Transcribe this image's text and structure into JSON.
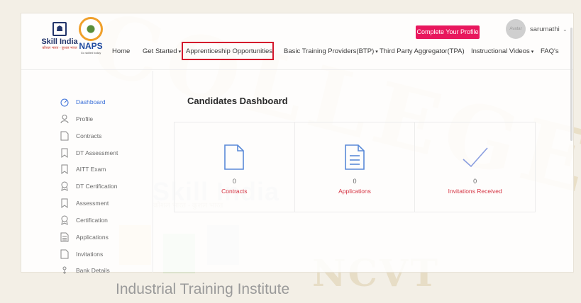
{
  "watermark": {
    "college": "COLLEGE",
    "ncvt": "NCVT",
    "iti": "Industrial Training Institute",
    "skill_india": "Skill India",
    "skill_india_sub": "कौशल भारत - कुशल भारत"
  },
  "header": {
    "skill_logo_title": "Skill India",
    "skill_logo_sub": "कौशल भारत - कुशल भारत",
    "naps_logo_title": "NAPS",
    "naps_logo_sub": "Go skilled today",
    "complete_profile_label": "Complete Your Profile",
    "avatar_text": "Avatar",
    "username": "sarumathi",
    "nav": [
      {
        "label": "Home"
      },
      {
        "label": "Get Started"
      },
      {
        "label": "Apprenticeship Opportunities"
      },
      {
        "label": "Basic Training Providers(BTP)"
      },
      {
        "label": "Third Party Aggregator(TPA)"
      },
      {
        "label": "Instructional Videos"
      },
      {
        "label": "FAQ's"
      }
    ]
  },
  "sidebar": {
    "items": [
      {
        "label": "Dashboard",
        "icon": "dashboard-icon"
      },
      {
        "label": "Profile",
        "icon": "user-icon"
      },
      {
        "label": "Contracts",
        "icon": "document-icon"
      },
      {
        "label": "DT Assessment",
        "icon": "bookmark-icon"
      },
      {
        "label": "AITT Exam",
        "icon": "bookmark-icon"
      },
      {
        "label": "DT Certification",
        "icon": "award-icon"
      },
      {
        "label": "Assessment",
        "icon": "bookmark-icon"
      },
      {
        "label": "Certification",
        "icon": "award-icon"
      },
      {
        "label": "Applications",
        "icon": "document-lines-icon"
      },
      {
        "label": "Invitations",
        "icon": "document-icon"
      },
      {
        "label": "Bank Details",
        "icon": "bank-icon"
      }
    ]
  },
  "main": {
    "title": "Candidates Dashboard",
    "stats": [
      {
        "value": "0",
        "label": "Contracts",
        "icon": "document-icon"
      },
      {
        "value": "0",
        "label": "Applications",
        "icon": "document-lines-icon"
      },
      {
        "value": "0",
        "label": "Invitations Received",
        "icon": "checkmark-icon"
      }
    ]
  },
  "colors": {
    "accent": "#3a6fd8",
    "brand_pink": "#e8175d",
    "highlight_red": "#d4182d",
    "stat_label": "#d53342"
  }
}
